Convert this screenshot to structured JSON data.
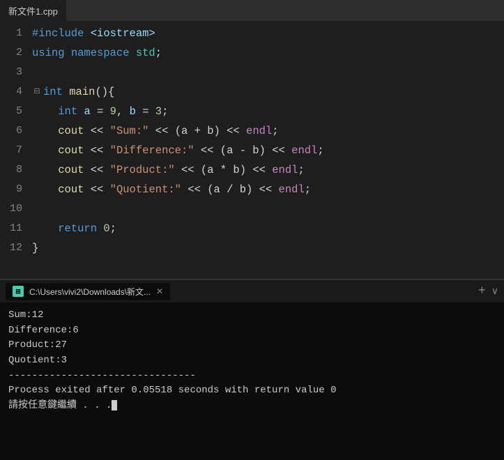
{
  "tab": {
    "filename": "新文件1.cpp"
  },
  "code": {
    "lines": [
      {
        "num": 1,
        "fold": false,
        "content": [
          {
            "t": "#include ",
            "c": "kw-blue"
          },
          {
            "t": "<iostream>",
            "c": "include-color"
          }
        ]
      },
      {
        "num": 2,
        "fold": false,
        "content": [
          {
            "t": "using ",
            "c": "kw-blue"
          },
          {
            "t": "namespace ",
            "c": "kw-blue"
          },
          {
            "t": "std",
            "c": "kw-green"
          },
          {
            "t": ";",
            "c": "plain"
          }
        ]
      },
      {
        "num": 3,
        "fold": false,
        "content": []
      },
      {
        "num": 4,
        "fold": true,
        "content": [
          {
            "t": "int ",
            "c": "kw-blue"
          },
          {
            "t": "main",
            "c": "kw-yellow"
          },
          {
            "t": "(){",
            "c": "plain"
          }
        ]
      },
      {
        "num": 5,
        "fold": false,
        "content": [
          {
            "t": "    ",
            "c": "plain"
          },
          {
            "t": "int ",
            "c": "kw-blue"
          },
          {
            "t": "a",
            "c": "var-color"
          },
          {
            "t": " = ",
            "c": "plain"
          },
          {
            "t": "9",
            "c": "num-color"
          },
          {
            "t": ", ",
            "c": "plain"
          },
          {
            "t": "b",
            "c": "var-color"
          },
          {
            "t": " = ",
            "c": "plain"
          },
          {
            "t": "3",
            "c": "num-color"
          },
          {
            "t": ";",
            "c": "plain"
          }
        ]
      },
      {
        "num": 6,
        "fold": false,
        "content": [
          {
            "t": "    ",
            "c": "plain"
          },
          {
            "t": "cout",
            "c": "kw-yellow"
          },
          {
            "t": " << ",
            "c": "plain"
          },
          {
            "t": "\"Sum:\"",
            "c": "string-dq"
          },
          {
            "t": " << ",
            "c": "plain"
          },
          {
            "t": "(a + b)",
            "c": "plain"
          },
          {
            "t": " << ",
            "c": "plain"
          },
          {
            "t": "endl",
            "c": "kw-purple"
          },
          {
            "t": ";",
            "c": "plain"
          }
        ]
      },
      {
        "num": 7,
        "fold": false,
        "content": [
          {
            "t": "    ",
            "c": "plain"
          },
          {
            "t": "cout",
            "c": "kw-yellow"
          },
          {
            "t": " << ",
            "c": "plain"
          },
          {
            "t": "\"Difference:\"",
            "c": "string-dq"
          },
          {
            "t": " << ",
            "c": "plain"
          },
          {
            "t": "(a - b)",
            "c": "plain"
          },
          {
            "t": " << ",
            "c": "plain"
          },
          {
            "t": "endl",
            "c": "kw-purple"
          },
          {
            "t": ";",
            "c": "plain"
          }
        ]
      },
      {
        "num": 8,
        "fold": false,
        "content": [
          {
            "t": "    ",
            "c": "plain"
          },
          {
            "t": "cout",
            "c": "kw-yellow"
          },
          {
            "t": " << ",
            "c": "plain"
          },
          {
            "t": "\"Product:\"",
            "c": "string-dq"
          },
          {
            "t": " << ",
            "c": "plain"
          },
          {
            "t": "(a * b)",
            "c": "plain"
          },
          {
            "t": " << ",
            "c": "plain"
          },
          {
            "t": "endl",
            "c": "kw-purple"
          },
          {
            "t": ";",
            "c": "plain"
          }
        ]
      },
      {
        "num": 9,
        "fold": false,
        "content": [
          {
            "t": "    ",
            "c": "plain"
          },
          {
            "t": "cout",
            "c": "kw-yellow"
          },
          {
            "t": " << ",
            "c": "plain"
          },
          {
            "t": "\"Quotient:\"",
            "c": "string-dq"
          },
          {
            "t": " << ",
            "c": "plain"
          },
          {
            "t": "(a / b)",
            "c": "plain"
          },
          {
            "t": " << ",
            "c": "plain"
          },
          {
            "t": "endl",
            "c": "kw-purple"
          },
          {
            "t": ";",
            "c": "plain"
          }
        ]
      },
      {
        "num": 10,
        "fold": false,
        "content": []
      },
      {
        "num": 11,
        "fold": false,
        "content": [
          {
            "t": "    ",
            "c": "plain"
          },
          {
            "t": "return ",
            "c": "kw-blue"
          },
          {
            "t": "0",
            "c": "num-color"
          },
          {
            "t": ";",
            "c": "plain"
          }
        ]
      },
      {
        "num": 12,
        "fold": false,
        "content": [
          {
            "t": "}",
            "c": "plain"
          }
        ]
      }
    ]
  },
  "terminal": {
    "tab_label": "C:\\Users\\vivi2\\Downloads\\新文...",
    "output": [
      "Sum:12",
      "Difference:6",
      "Product:27",
      "Quotient:3",
      "",
      "--------------------------------",
      "Process exited after 0.05518 seconds with return value 0",
      "請按任意鍵繼續 . . ."
    ]
  }
}
